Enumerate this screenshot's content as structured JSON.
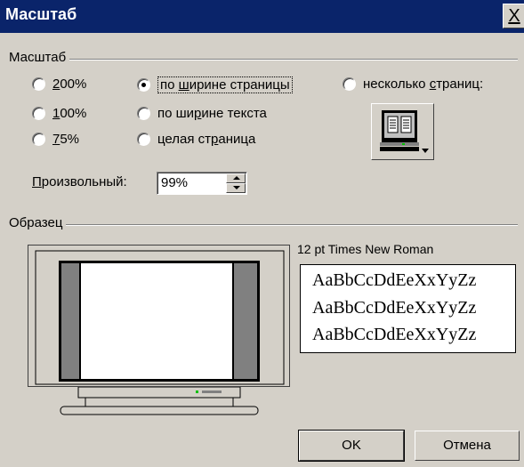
{
  "window": {
    "title": "Масштаб",
    "close_label": "X"
  },
  "zoom_group": {
    "title": "Масштаб",
    "options": [
      {
        "label_pre": "",
        "mnemonic": "2",
        "label_post": "00%",
        "selected": false
      },
      {
        "label_pre": "",
        "mnemonic": "1",
        "label_post": "00%",
        "selected": false
      },
      {
        "label_pre": "",
        "mnemonic": "7",
        "label_post": "5%",
        "selected": false
      },
      {
        "label_pre": "по ",
        "mnemonic": "ш",
        "label_post": "ирине страницы",
        "selected": true
      },
      {
        "label_pre": "по ши",
        "mnemonic": "р",
        "label_post": "ине текста",
        "selected": false
      },
      {
        "label_pre": "целая ст",
        "mnemonic": "р",
        "label_post": "аница",
        "selected": false
      },
      {
        "label_pre": "несколько ",
        "mnemonic": "с",
        "label_post": "траниц:",
        "selected": false
      }
    ],
    "custom_label_mnemonic": "П",
    "custom_label_rest": "роизвольный:",
    "custom_value": "99%"
  },
  "preview_group": {
    "title": "Образец",
    "font_label": "12 pt Times New Roman",
    "sample_lines": [
      "AaBbCcDdEeXxYyZz",
      "AaBbCcDdEeXxYyZz",
      "AaBbCcDdEeXxYyZz"
    ]
  },
  "buttons": {
    "ok": "OK",
    "cancel": "Отмена"
  }
}
